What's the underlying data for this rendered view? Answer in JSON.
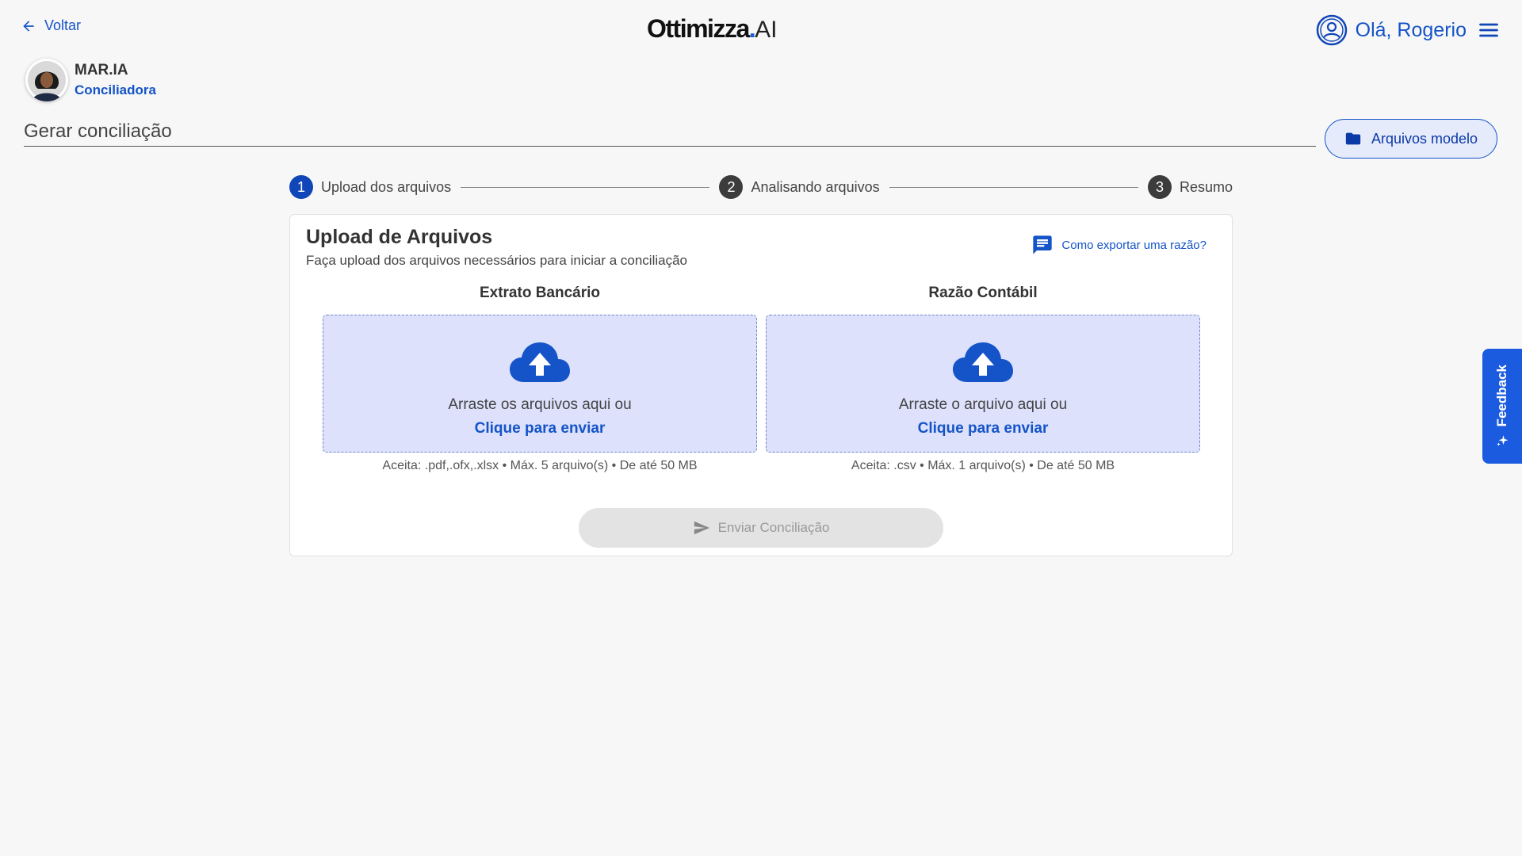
{
  "header": {
    "back_label": "Voltar",
    "logo_main": "Ottimizza",
    "logo_dot": ".",
    "logo_suffix": "AI",
    "greeting": "Olá, Rogerio"
  },
  "agent": {
    "name": "MAR.IA",
    "role": "Conciliadora"
  },
  "page": {
    "title": "Gerar conciliação",
    "model_button": "Arquivos modelo"
  },
  "stepper": {
    "steps": [
      {
        "number": "1",
        "label": "Upload dos arquivos",
        "state": "active"
      },
      {
        "number": "2",
        "label": "Analisando arquivos",
        "state": "inactive"
      },
      {
        "number": "3",
        "label": "Resumo",
        "state": "inactive"
      }
    ]
  },
  "card": {
    "title": "Upload de Arquivos",
    "subtitle": "Faça upload dos arquivos necessários para iniciar a conciliação",
    "help_link": "Como exportar uma razão?",
    "columns": [
      {
        "heading": "Extrato Bancário",
        "drop_text": "Arraste os arquivos aqui ou",
        "drop_link": "Clique para enviar",
        "accept": "Aceita: .pdf,.ofx,.xlsx • Máx. 5 arquivo(s) • De até 50 MB"
      },
      {
        "heading": "Razão Contábil",
        "drop_text": "Arraste o arquivo aqui ou",
        "drop_link": "Clique para enviar",
        "accept": "Aceita: .csv • Máx. 1 arquivo(s) • De até 50 MB"
      }
    ],
    "send_button": "Enviar Conciliação"
  },
  "feedback": {
    "label": "Feedback"
  },
  "colors": {
    "primary": "#1454c8",
    "step_active": "#1046b8",
    "dropzone_bg": "#dde1fc",
    "feedback_bg": "#1a5be0"
  }
}
